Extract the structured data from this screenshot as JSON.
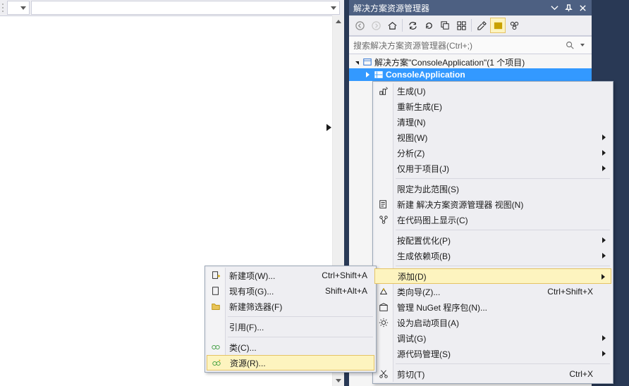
{
  "solution_explorer": {
    "title": "解决方案资源管理器",
    "search_placeholder": "搜索解决方案资源管理器(Ctrl+;)",
    "solution_line_prefix": "解决方案\"ConsoleApplication\"(1 个项目)",
    "project_cut": "ConsoleApplication"
  },
  "submenu": {
    "0": {
      "label": "新建项(W)...",
      "shortcut": "Ctrl+Shift+A"
    },
    "1": {
      "label": "现有项(G)...",
      "shortcut": "Shift+Alt+A"
    },
    "2": {
      "label": "新建筛选器(F)"
    },
    "3": {
      "label": "引用(F)..."
    },
    "4": {
      "label": "类(C)..."
    },
    "5": {
      "label": "资源(R)..."
    }
  },
  "mainmenu": {
    "0": {
      "label": "生成(U)"
    },
    "1": {
      "label": "重新生成(E)"
    },
    "2": {
      "label": "清理(N)"
    },
    "3": {
      "label": "视图(W)"
    },
    "4": {
      "label": "分析(Z)"
    },
    "5": {
      "label": "仅用于项目(J)"
    },
    "6": {
      "label": "限定为此范围(S)"
    },
    "7": {
      "label": "新建 解决方案资源管理器 视图(N)"
    },
    "8": {
      "label": "在代码图上显示(C)"
    },
    "9": {
      "label": "按配置优化(P)"
    },
    "10": {
      "label": "生成依赖项(B)"
    },
    "11": {
      "label": "添加(D)"
    },
    "12": {
      "label": "类向导(Z)...",
      "shortcut": "Ctrl+Shift+X"
    },
    "13": {
      "label": "管理 NuGet 程序包(N)..."
    },
    "14": {
      "label": "设为启动项目(A)"
    },
    "15": {
      "label": "调试(G)"
    },
    "16": {
      "label": "源代码管理(S)"
    },
    "17": {
      "label": "剪切(T)",
      "shortcut": "Ctrl+X"
    }
  }
}
